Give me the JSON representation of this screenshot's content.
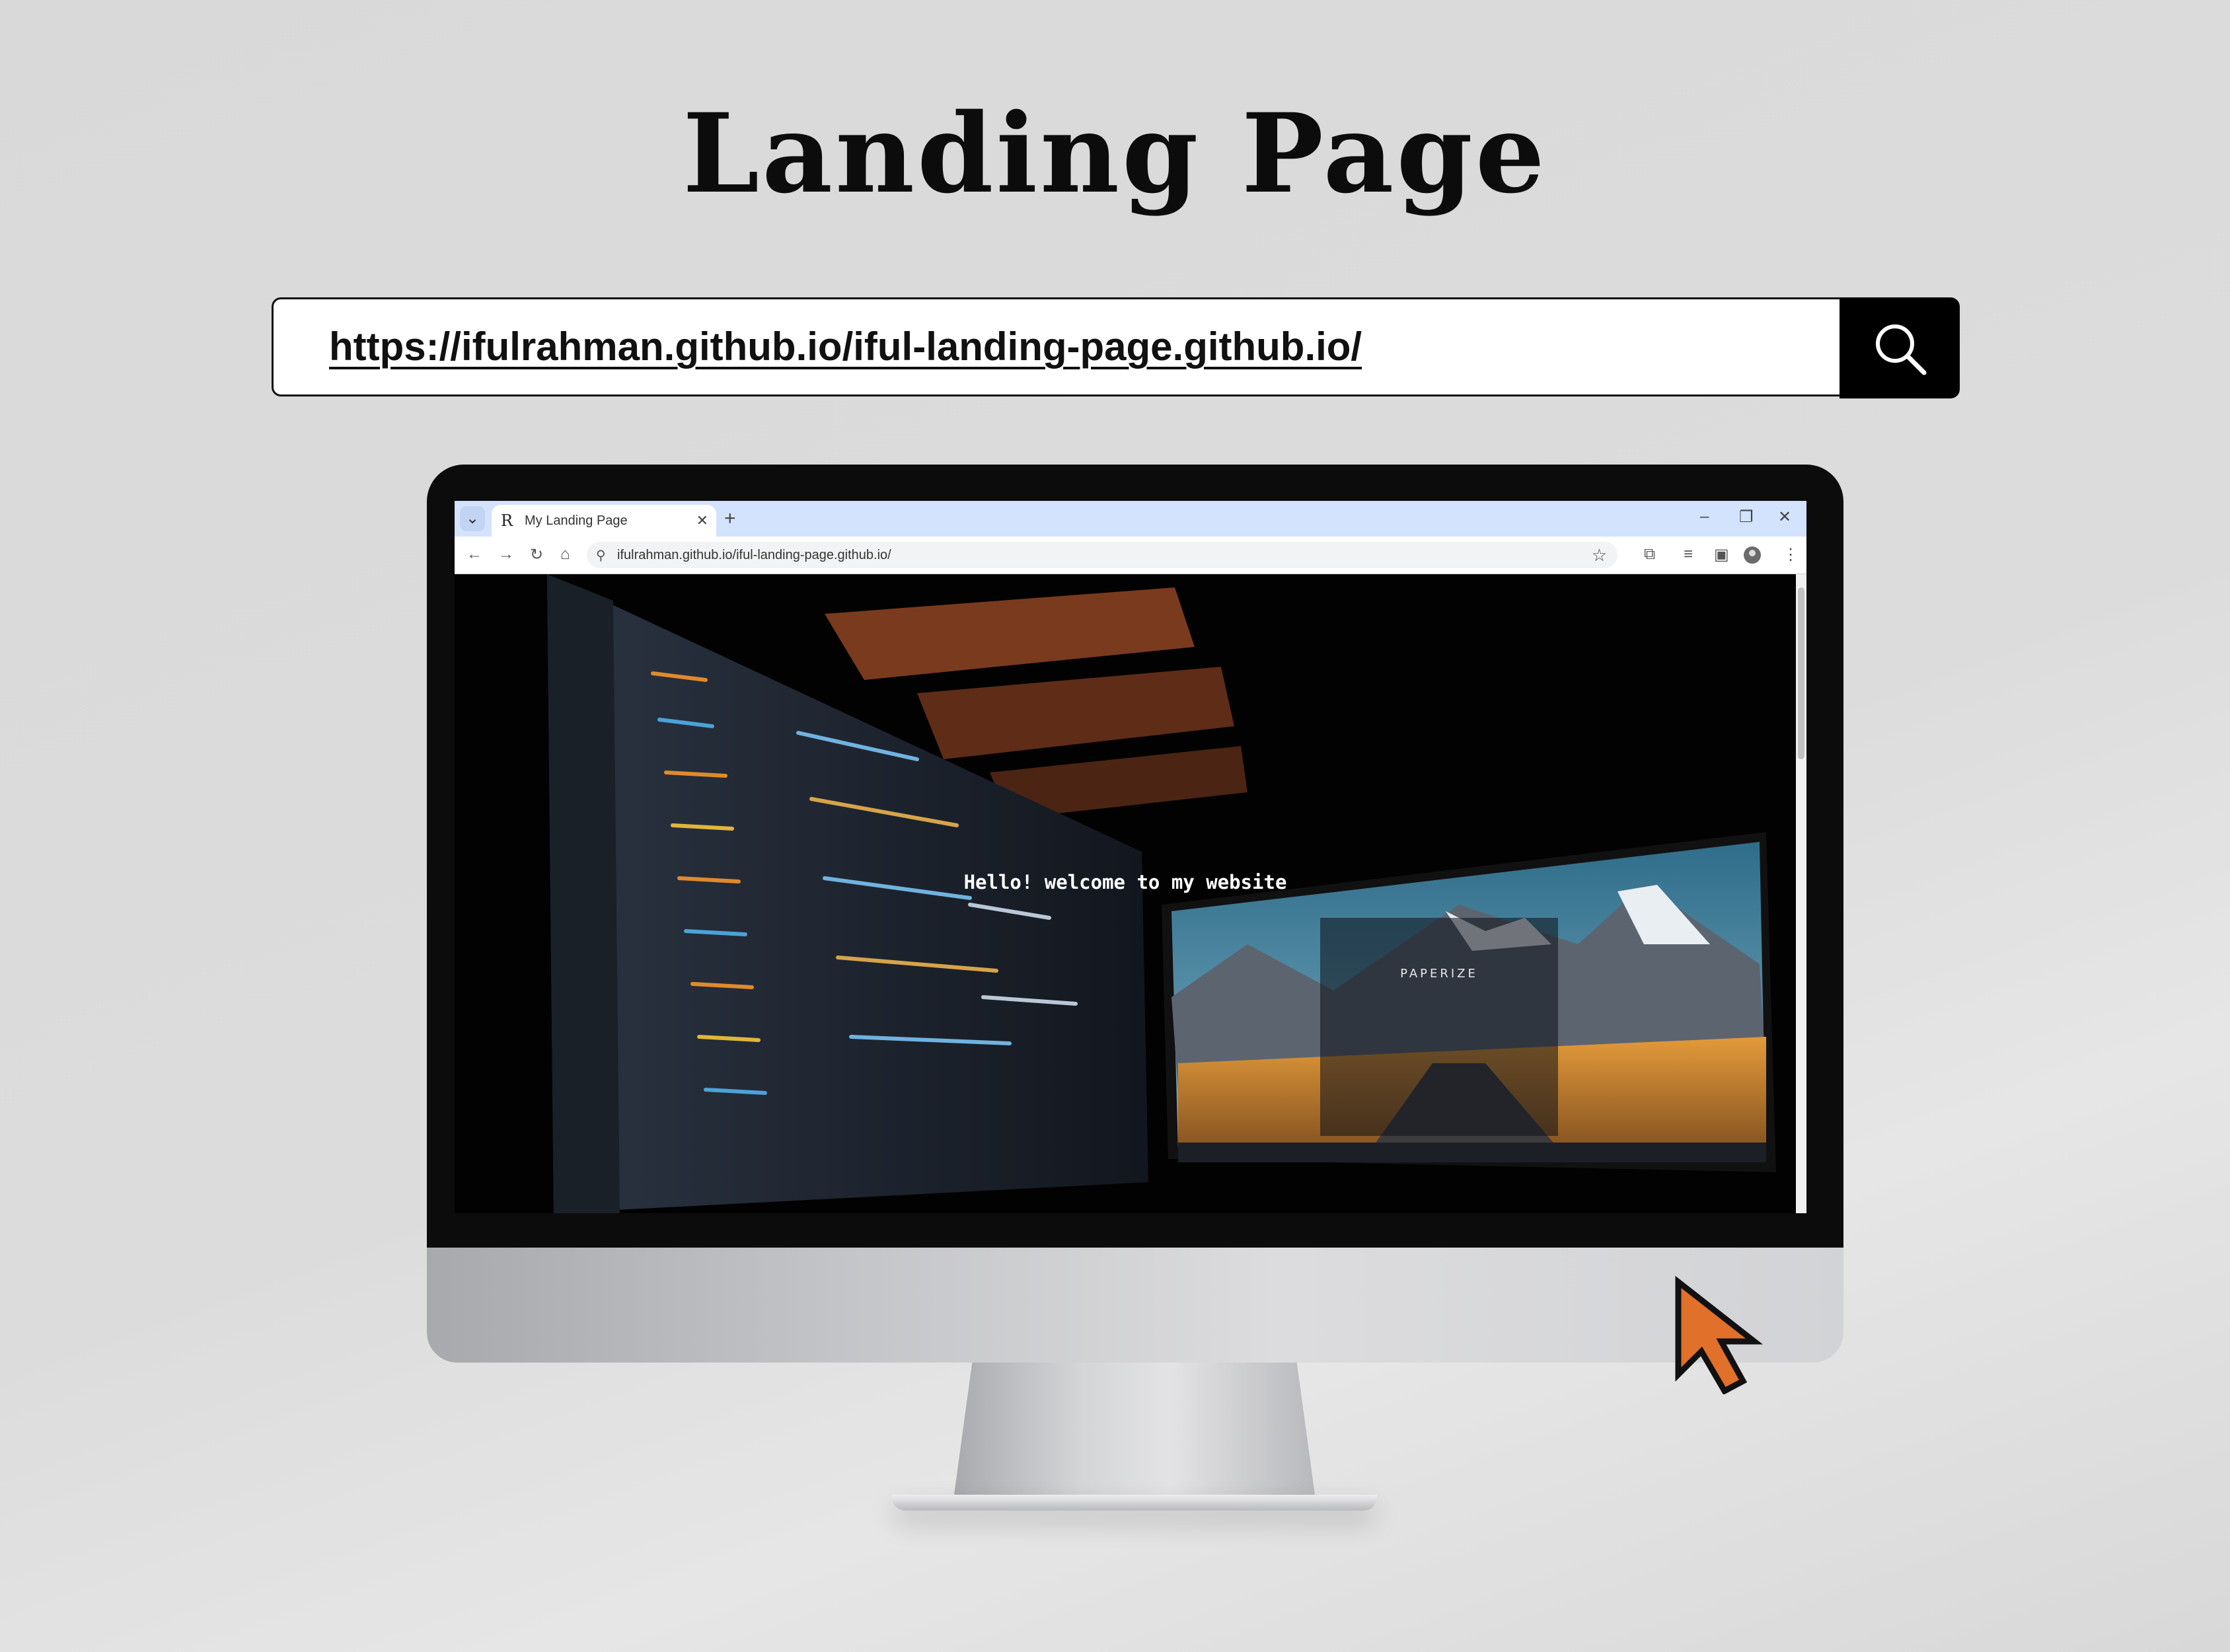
{
  "header": {
    "title": "Landing Page"
  },
  "url_display": {
    "url": "https://ifulrahman.github.io/iful-landing-page.github.io/",
    "icon": "search-icon"
  },
  "browser": {
    "tab_title": "My Landing Page",
    "tab_favicon": "R",
    "new_tab": "+",
    "address": "ifulrahman.github.io/iful-landing-page.github.io/",
    "window_controls": [
      "–",
      "❐",
      "✕"
    ]
  },
  "webpage": {
    "hero_text": "Hello! welcome to my website",
    "inner_screen_title": "PAPERIZE"
  },
  "colors": {
    "background": "#dadada",
    "bezel": "#0c0c0c",
    "tabstrip": "#d3e3fd",
    "cursor": "#e0702a"
  }
}
